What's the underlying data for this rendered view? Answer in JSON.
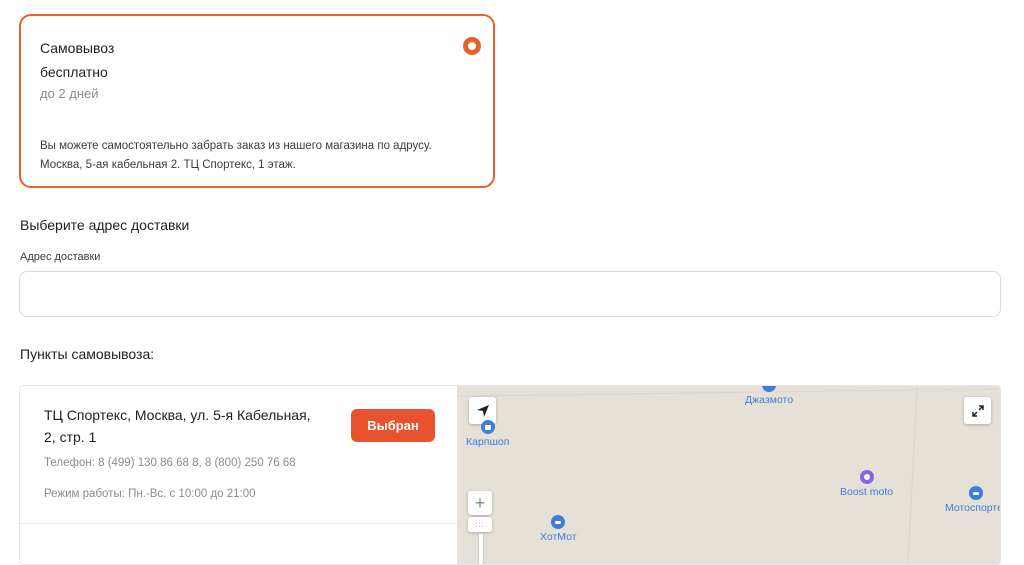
{
  "delivery_option": {
    "title": "Самовывоз",
    "price": "бесплатно",
    "duration": "до 2 дней",
    "description": "Вы можете самостоятельно забрать заказ из нашего магазина по адрусу. Москва, 5-ая кабельная 2. ТЦ Спортекс, 1 этаж.",
    "selected": true
  },
  "address_section": {
    "heading": "Выберите адрес доставки",
    "field_label": "Адрес доставки",
    "field_value": ""
  },
  "pickup_section": {
    "heading": "Пункты самовывоза:",
    "points": [
      {
        "name": "ТЦ Спортекс, Москва, ул. 5-я Кабельная, 2, стр. 1",
        "phone": "Телефон: 8 (499) 130 86 68 8, 8 (800) 250 76 68",
        "hours": "Режим работы: Пн.-Вс. с 10:00 до 21:00",
        "button_label": "Выбран"
      }
    ]
  },
  "map": {
    "pois": [
      {
        "label": "Джазмото",
        "icon": "motorcycle-icon"
      },
      {
        "label": "Карпшоп",
        "icon": "shopping-bag-icon"
      },
      {
        "label": "Boost moto",
        "icon": "place-icon"
      },
      {
        "label": "Мотоспортек",
        "icon": "car-icon"
      },
      {
        "label": "ХотМот",
        "icon": "car-icon"
      }
    ],
    "controls": {
      "locate": "locate-arrow-icon",
      "fullscreen": "expand-icon",
      "zoom_in": "+",
      "zoom_grip": ":::"
    }
  },
  "colors": {
    "accent": "#e9602f",
    "button": "#e9522f",
    "map_bg": "#e5e1d8",
    "poi_blue": "#3e7ed6",
    "poi_purple": "#8a63e0"
  }
}
